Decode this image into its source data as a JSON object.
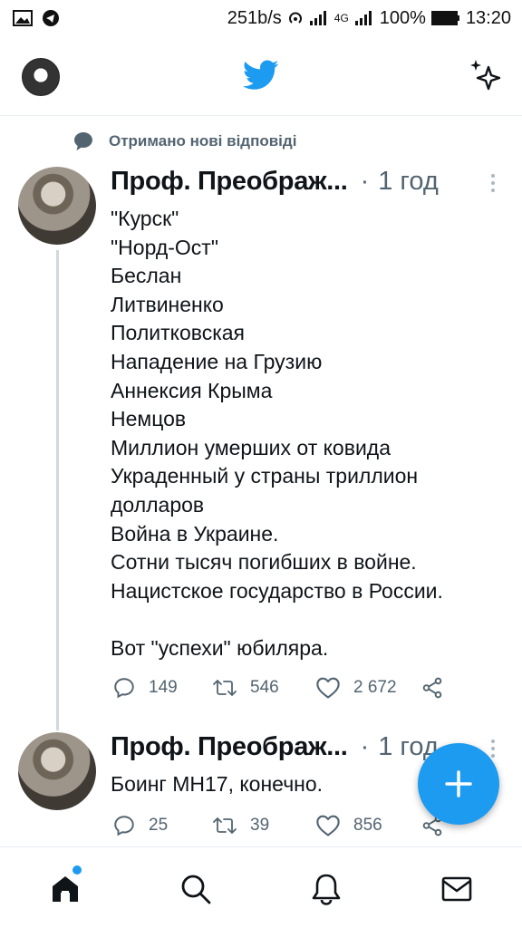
{
  "statusbar": {
    "speed": "251b/s",
    "network": "4G",
    "battery": "100%",
    "time": "13:20"
  },
  "header": {
    "logo_icon": "twitter-bird-icon",
    "sparkle_icon": "sparkle-icon",
    "brand_color": "#1d9bf0"
  },
  "notice": {
    "text": "Отримано нові відповіді"
  },
  "tweets": [
    {
      "name": "Проф. Преображ...",
      "dot": "·",
      "time": "1 год",
      "body": "\"Курск\"\n\"Норд-Ост\"\nБеслан\nЛитвиненко\nПолитковская\nНападение на Грузию\nАннексия Крыма\nНемцов\nМиллион умерших от ковида\nУкраденный у страны триллион\nдолларов\nВойна в Украине.\nСотни тысяч погибших в войне.\nНацистское государство в России.\n\nВот \"успехи\" юбиляра.",
      "replies": "149",
      "retweets": "546",
      "likes": "2 672"
    },
    {
      "name": "Проф. Преображ...",
      "dot": "·",
      "time": "1 год",
      "body": "Боинг МН17, конечно.",
      "replies": "25",
      "retweets": "39",
      "likes": "856"
    }
  ]
}
